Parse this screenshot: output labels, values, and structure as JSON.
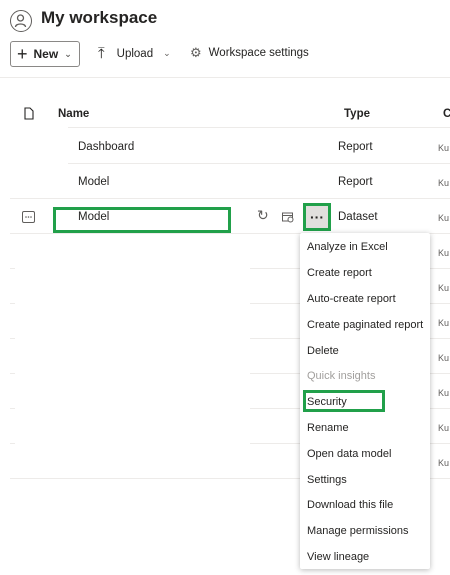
{
  "header": {
    "title": "My workspace",
    "icon": "person-icon"
  },
  "toolbar": {
    "new_label": "New",
    "upload_label": "Upload",
    "settings_label": "Workspace settings"
  },
  "table": {
    "columns": [
      "Name",
      "Type",
      "C"
    ],
    "rows": [
      {
        "name": "Dashboard",
        "type": "Report",
        "owner": "Ku"
      },
      {
        "name": "Model",
        "type": "Report",
        "owner": "Ku"
      },
      {
        "name": "Model",
        "type": "Dataset",
        "owner": "Ku"
      },
      {
        "owner": "Ku"
      },
      {
        "owner": "Ku"
      },
      {
        "owner": "Ku"
      },
      {
        "owner": "Ku"
      },
      {
        "owner": "Ku"
      },
      {
        "owner": "Ku"
      },
      {
        "owner": "Ku"
      }
    ],
    "more_label": "···"
  },
  "context_menu": {
    "items": [
      {
        "label": "Analyze in Excel",
        "disabled": false
      },
      {
        "label": "Create report",
        "disabled": false
      },
      {
        "label": "Auto-create report",
        "disabled": false
      },
      {
        "label": "Create paginated report",
        "disabled": false
      },
      {
        "label": "Delete",
        "disabled": false
      },
      {
        "label": "Quick insights",
        "disabled": true
      },
      {
        "label": "Security",
        "disabled": false
      },
      {
        "label": "Rename",
        "disabled": false
      },
      {
        "label": "Open data model",
        "disabled": false
      },
      {
        "label": "Settings",
        "disabled": false
      },
      {
        "label": "Download this file",
        "disabled": false
      },
      {
        "label": "Manage permissions",
        "disabled": false
      },
      {
        "label": "View lineage",
        "disabled": false
      }
    ]
  },
  "colors": {
    "highlight": "#21a04a",
    "disabled_text": "#a19f9d"
  }
}
